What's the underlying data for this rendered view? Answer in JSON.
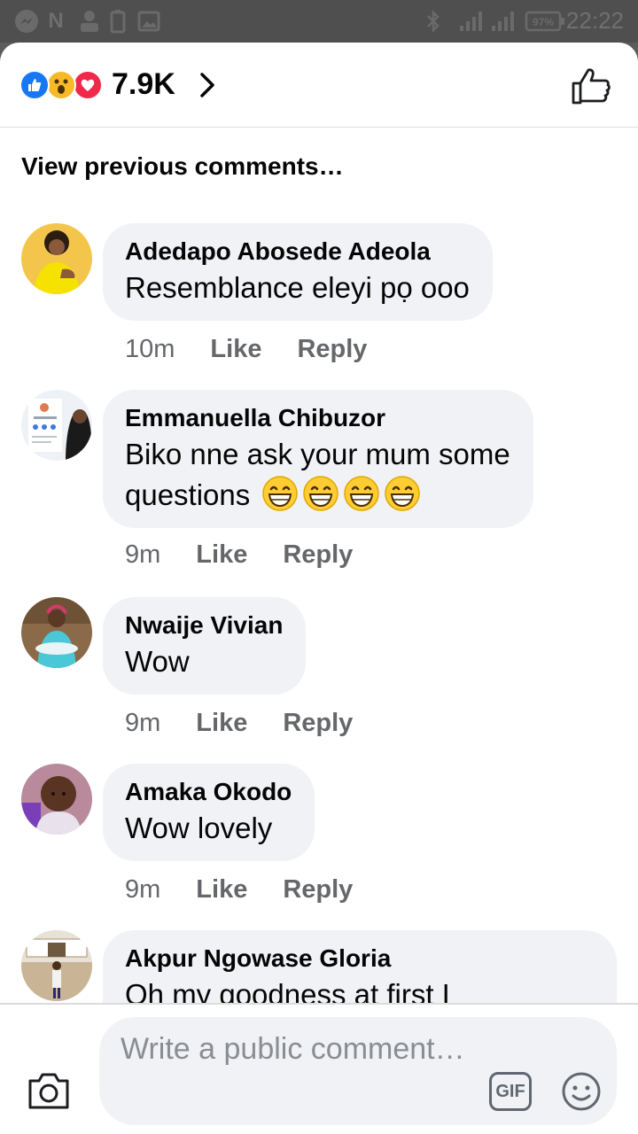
{
  "status_bar": {
    "time": "22:22",
    "battery": "97%",
    "icons": [
      "messenger-icon",
      "n-app-icon",
      "person-app-icon",
      "battery-saver-icon",
      "image-icon",
      "bluetooth-icon",
      "signal-icon",
      "signal-icon",
      "battery-icon"
    ]
  },
  "reactions": {
    "count": "7.9K",
    "types": [
      "like",
      "wow",
      "love"
    ],
    "colors": {
      "like": "#1877f2",
      "wow": "#f7b928",
      "love": "#f02849"
    }
  },
  "view_previous": "View previous comments…",
  "comments": [
    {
      "author": "Adedapo Abosede Adeola",
      "text": "Resemblance eleyi pọ ooo",
      "time": "10m",
      "like": "Like",
      "reply": "Reply"
    },
    {
      "author": "Emmanuella Chibuzor",
      "text_line1": "Biko nne ask your mum some",
      "text_line2": "questions",
      "emoji_count": 4,
      "emoji": "grinning-face",
      "time": "9m",
      "like": "Like",
      "reply": "Reply"
    },
    {
      "author": "Nwaije Vivian",
      "text": "Wow",
      "time": "9m",
      "like": "Like",
      "reply": "Reply"
    },
    {
      "author": "Amaka Okodo",
      "text": "Wow lovely",
      "time": "9m",
      "like": "Like",
      "reply": "Reply"
    },
    {
      "author": "Akpur Ngowase Gloria",
      "text": "Oh my goodness at first I"
    }
  ],
  "composer": {
    "placeholder": "Write a public comment…",
    "gif_label": "GIF"
  },
  "colors": {
    "bubble": "#f0f2f5",
    "meta_text": "#65676b",
    "placeholder": "#8a8d91"
  }
}
